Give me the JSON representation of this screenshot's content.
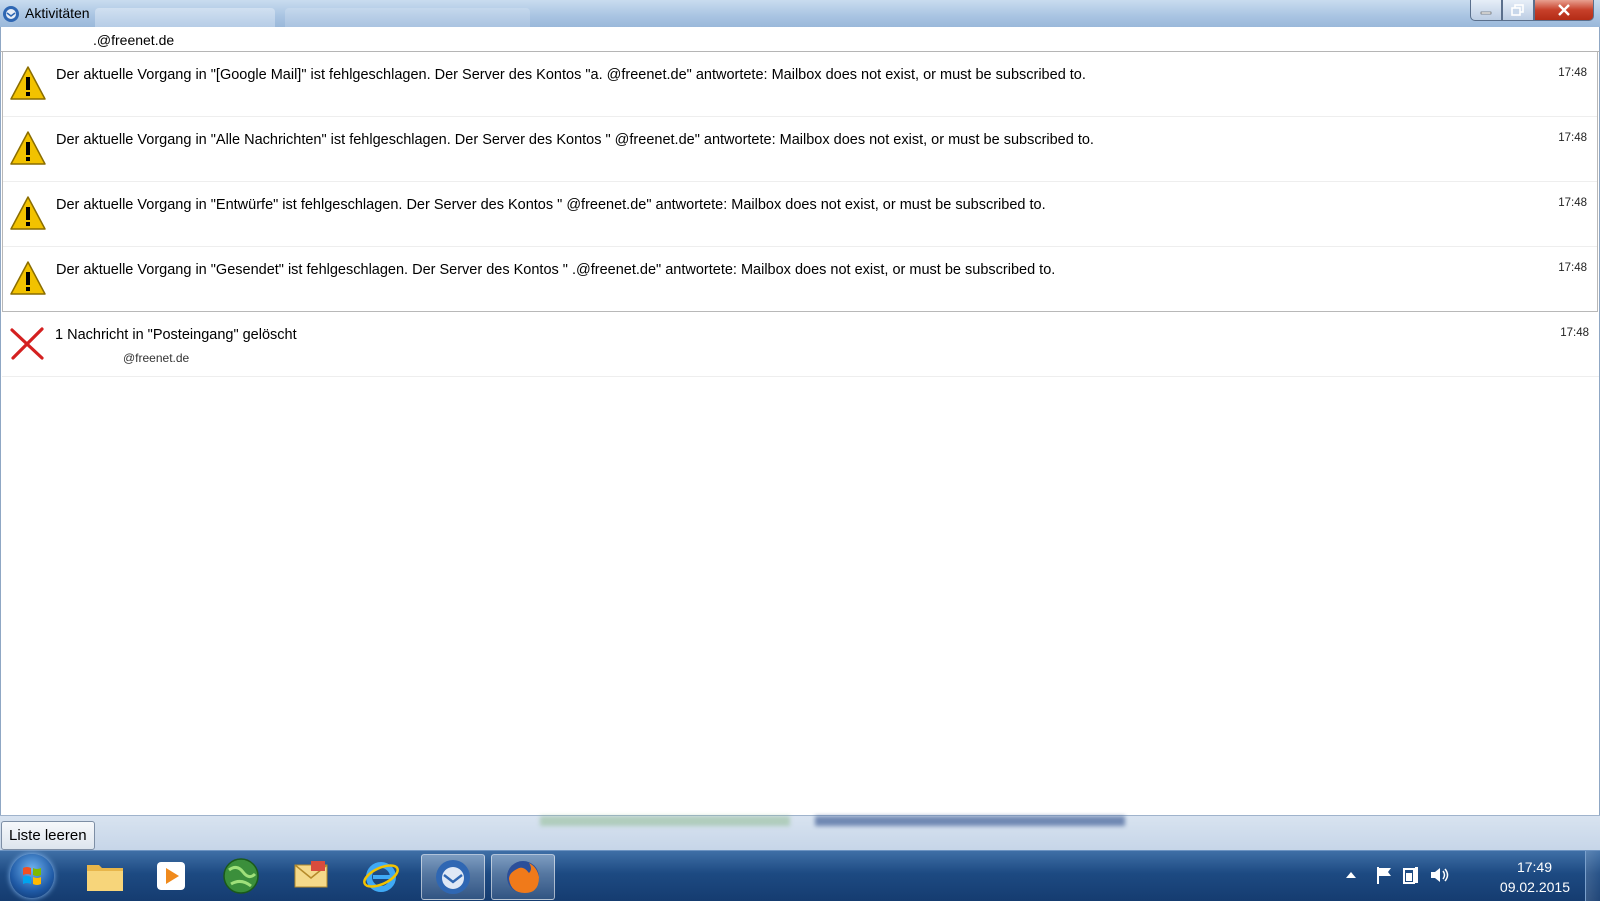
{
  "window": {
    "title": "Aktivitäten"
  },
  "account": {
    "label": ".@freenet.de"
  },
  "failures": [
    {
      "message": "Der aktuelle Vorgang in \"[Google Mail]\" ist fehlgeschlagen. Der Server des Kontos \"a.             @freenet.de\" antwortete: Mailbox does not exist, or must be subscribed to.",
      "time": "17:48"
    },
    {
      "message": "Der aktuelle Vorgang in \"Alle Nachrichten\" ist fehlgeschlagen. Der Server des Kontos \"                   @freenet.de\" antwortete: Mailbox does not exist, or must be subscribed to.",
      "time": "17:48"
    },
    {
      "message": "Der aktuelle Vorgang in \"Entwürfe\" ist fehlgeschlagen. Der Server des Kontos \"                    @freenet.de\" antwortete: Mailbox does not exist, or must be subscribed to.",
      "time": "17:48"
    },
    {
      "message": "Der aktuelle Vorgang in \"Gesendet\" ist fehlgeschlagen. Der Server des Kontos \"                   .@freenet.de\" antwortete: Mailbox does not exist, or must be subscribed to.",
      "time": "17:48"
    }
  ],
  "deleted": {
    "message": "1 Nachricht in \"Posteingang\" gelöscht",
    "sub": "@freenet.de",
    "time": "17:48"
  },
  "footer": {
    "clear_label": "Liste leeren"
  },
  "taskbar": {
    "apps": [
      "explorer-folder-icon",
      "media-player-icon",
      "globe-icon",
      "mail-icon",
      "internet-explorer-icon",
      "thunderbird-icon",
      "firefox-icon"
    ],
    "clock_time": "17:49",
    "clock_date": "09.02.2015"
  },
  "colors": {
    "warning": "#f2c200",
    "delete": "#d42020",
    "taskbar": "#1d4a82"
  }
}
